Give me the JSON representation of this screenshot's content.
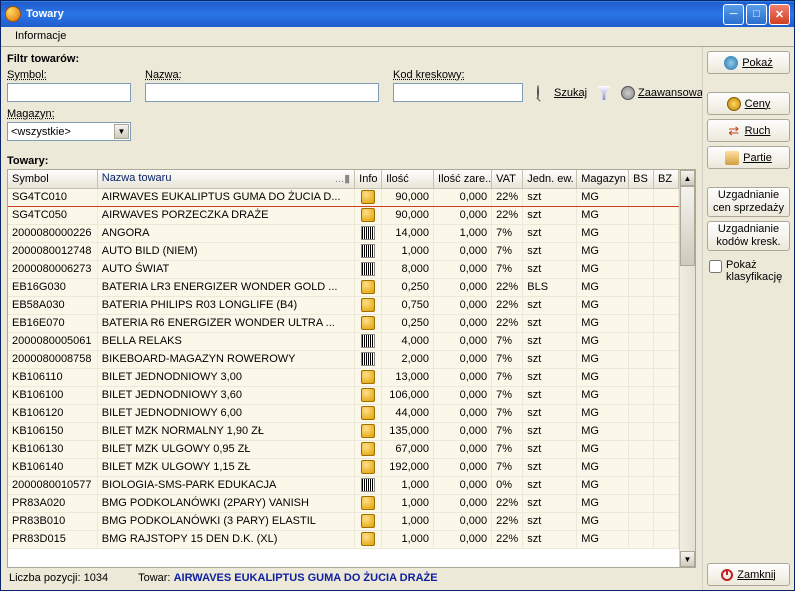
{
  "title": "Towary",
  "menu": {
    "informacje": "Informacje"
  },
  "filter": {
    "title": "Filtr towarów:",
    "symbol_label": "Symbol:",
    "name_label": "Nazwa:",
    "barcode_label": "Kod kreskowy:",
    "search": "Szukaj",
    "advanced": "Zaawansowane",
    "magazyn_label": "Magazyn:",
    "magazyn_value": "<wszystkie>"
  },
  "grid": {
    "title": "Towary:",
    "headers": {
      "symbol": "Symbol",
      "name": "Nazwa towaru",
      "info": "Info",
      "ilosc": "Ilość",
      "ilosc_zare": "Ilość zare...",
      "vat": "VAT",
      "jedn": "Jedn. ew.",
      "magazyn": "Magazyn",
      "bs": "BS",
      "bz": "BZ"
    },
    "rows": [
      {
        "symbol": "SG4TC010",
        "name": "AIRWAVES EUKALIPTUS GUMA DO ŻUCIA D...",
        "icon": "cube",
        "ilosc": "90,000",
        "iloscz": "0,000",
        "vat": "22%",
        "jedn": "szt",
        "mag": "MG"
      },
      {
        "symbol": "SG4TC050",
        "name": "AIRWAVES PORZECZKA DRAŻE",
        "icon": "cube",
        "ilosc": "90,000",
        "iloscz": "0,000",
        "vat": "22%",
        "jedn": "szt",
        "mag": "MG"
      },
      {
        "symbol": "2000080000226",
        "name": "ANGORA",
        "icon": "barcode",
        "ilosc": "14,000",
        "iloscz": "1,000",
        "vat": "7%",
        "jedn": "szt",
        "mag": "MG"
      },
      {
        "symbol": "2000080012748",
        "name": "AUTO BILD (NIEM)",
        "icon": "barcode",
        "ilosc": "1,000",
        "iloscz": "0,000",
        "vat": "7%",
        "jedn": "szt",
        "mag": "MG"
      },
      {
        "symbol": "2000080006273",
        "name": "AUTO ŚWIAT",
        "icon": "barcode",
        "ilosc": "8,000",
        "iloscz": "0,000",
        "vat": "7%",
        "jedn": "szt",
        "mag": "MG"
      },
      {
        "symbol": "EB16G030",
        "name": "BATERIA LR3 ENERGIZER WONDER GOLD ...",
        "icon": "cube",
        "ilosc": "0,250",
        "iloscz": "0,000",
        "vat": "22%",
        "jedn": "BLS",
        "mag": "MG"
      },
      {
        "symbol": "EB58A030",
        "name": "BATERIA PHILIPS R03 LONGLIFE (B4)",
        "icon": "cube",
        "ilosc": "0,750",
        "iloscz": "0,000",
        "vat": "22%",
        "jedn": "szt",
        "mag": "MG"
      },
      {
        "symbol": "EB16E070",
        "name": "BATERIA R6 ENERGIZER WONDER ULTRA ...",
        "icon": "cube",
        "ilosc": "0,250",
        "iloscz": "0,000",
        "vat": "22%",
        "jedn": "szt",
        "mag": "MG"
      },
      {
        "symbol": "2000080005061",
        "name": "BELLA RELAKS",
        "icon": "barcode",
        "ilosc": "4,000",
        "iloscz": "0,000",
        "vat": "7%",
        "jedn": "szt",
        "mag": "MG"
      },
      {
        "symbol": "2000080008758",
        "name": "BIKEBOARD-MAGAZYN ROWEROWY",
        "icon": "barcode",
        "ilosc": "2,000",
        "iloscz": "0,000",
        "vat": "7%",
        "jedn": "szt",
        "mag": "MG"
      },
      {
        "symbol": "KB106110",
        "name": "BILET JEDNODNIOWY 3,00",
        "icon": "cube",
        "ilosc": "13,000",
        "iloscz": "0,000",
        "vat": "7%",
        "jedn": "szt",
        "mag": "MG"
      },
      {
        "symbol": "KB106100",
        "name": "BILET JEDNODNIOWY 3,60",
        "icon": "cube",
        "ilosc": "106,000",
        "iloscz": "0,000",
        "vat": "7%",
        "jedn": "szt",
        "mag": "MG"
      },
      {
        "symbol": "KB106120",
        "name": "BILET JEDNODNIOWY 6,00",
        "icon": "cube",
        "ilosc": "44,000",
        "iloscz": "0,000",
        "vat": "7%",
        "jedn": "szt",
        "mag": "MG"
      },
      {
        "symbol": "KB106150",
        "name": "BILET MZK NORMALNY 1,90 ZŁ",
        "icon": "cube",
        "ilosc": "135,000",
        "iloscz": "0,000",
        "vat": "7%",
        "jedn": "szt",
        "mag": "MG"
      },
      {
        "symbol": "KB106130",
        "name": "BILET MZK ULGOWY 0,95 ZŁ",
        "icon": "cube",
        "ilosc": "67,000",
        "iloscz": "0,000",
        "vat": "7%",
        "jedn": "szt",
        "mag": "MG"
      },
      {
        "symbol": "KB106140",
        "name": "BILET MZK ULGOWY 1,15 ZŁ",
        "icon": "cube",
        "ilosc": "192,000",
        "iloscz": "0,000",
        "vat": "7%",
        "jedn": "szt",
        "mag": "MG"
      },
      {
        "symbol": "2000080010577",
        "name": "BIOLOGIA-SMS-PARK EDUKACJA",
        "icon": "barcode",
        "ilosc": "1,000",
        "iloscz": "0,000",
        "vat": "0%",
        "jedn": "szt",
        "mag": "MG"
      },
      {
        "symbol": "PR83A020",
        "name": "BMG PODKOLANÓWKI (2PARY) VANISH",
        "icon": "cube",
        "ilosc": "1,000",
        "iloscz": "0,000",
        "vat": "22%",
        "jedn": "szt",
        "mag": "MG"
      },
      {
        "symbol": "PR83B010",
        "name": "BMG PODKOLANÓWKI (3 PARY) ELASTIL",
        "icon": "cube",
        "ilosc": "1,000",
        "iloscz": "0,000",
        "vat": "22%",
        "jedn": "szt",
        "mag": "MG"
      },
      {
        "symbol": "PR83D015",
        "name": "BMG RAJSTOPY 15 DEN D.K. (XL)",
        "icon": "cube",
        "ilosc": "1,000",
        "iloscz": "0,000",
        "vat": "22%",
        "jedn": "szt",
        "mag": "MG"
      }
    ]
  },
  "status": {
    "count_label": "Liczba pozycji:",
    "count": "1034",
    "towar_label": "Towar:",
    "towar_name": "AIRWAVES EUKALIPTUS GUMA DO ŻUCIA DRAŻE"
  },
  "side": {
    "pokaz": "Pokaż",
    "ceny": "Ceny",
    "ruch": "Ruch",
    "partie": "Partie",
    "uzg_cen": "Uzgadnianie cen sprzedaży",
    "uzg_kod": "Uzgadnianie kodów kresk.",
    "pokaz_klas": "Pokaż klasyfikację",
    "zamknij": "Zamknij"
  }
}
